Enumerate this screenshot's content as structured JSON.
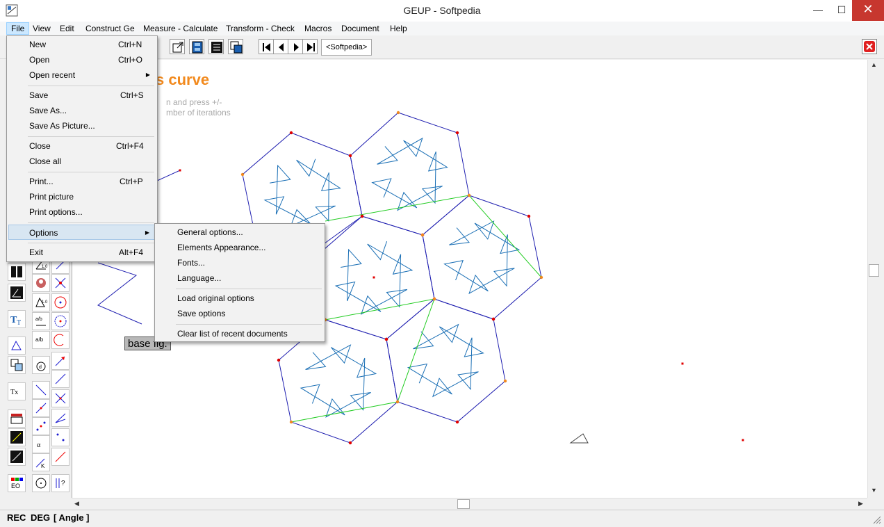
{
  "window": {
    "title": "GEUP - Softpedia",
    "minimize": "—",
    "maximize": "☐",
    "close": "✕"
  },
  "menubar": [
    "File",
    "View",
    "Edit",
    "Construct Ge",
    "Measure - Calculate",
    "Transform - Check",
    "Macros",
    "Document",
    "Help"
  ],
  "toolbar": {
    "tab_label": "<Softpedia>"
  },
  "figure": {
    "title_fragment": "s curve",
    "subtitle_line1": "n and press +/-",
    "subtitle_line2": "mber of iterations",
    "base_label": "base fig."
  },
  "file_menu": {
    "items": [
      {
        "label": "New",
        "shortcut": "Ctrl+N"
      },
      {
        "label": "Open",
        "shortcut": "Ctrl+O"
      },
      {
        "label": "Open recent",
        "shortcut": ""
      },
      {
        "label": "Save",
        "shortcut": "Ctrl+S"
      },
      {
        "label": "Save As...",
        "shortcut": ""
      },
      {
        "label": "Save As Picture...",
        "shortcut": ""
      },
      {
        "label": "Close",
        "shortcut": "Ctrl+F4"
      },
      {
        "label": "Close all",
        "shortcut": ""
      },
      {
        "label": "Print...",
        "shortcut": "Ctrl+P"
      },
      {
        "label": "Print picture",
        "shortcut": ""
      },
      {
        "label": "Print options...",
        "shortcut": ""
      },
      {
        "label": "Options",
        "shortcut": ""
      },
      {
        "label": "Exit",
        "shortcut": "Alt+F4"
      }
    ]
  },
  "options_menu": {
    "items": [
      "General options...",
      "Elements Appearance...",
      "Fonts...",
      "Language...",
      "Load original options",
      "Save options",
      "Clear list of recent documents"
    ]
  },
  "status": {
    "rec": "REC",
    "deg": "DEG",
    "mode": "[ Angle ]"
  },
  "colors": {
    "accent_orange": "#f28a1e",
    "curve_blue": "#1a6fb5",
    "hex_blue": "#1f1fb0",
    "green_lines": "#22cc22",
    "red_point": "#e00000",
    "menu_hover": "#d8e6f2"
  }
}
